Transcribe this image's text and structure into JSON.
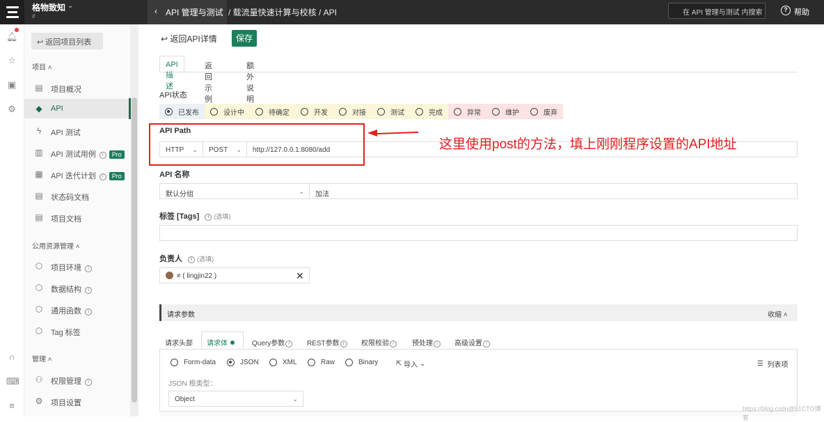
{
  "app": {
    "name": "格物致知",
    "sub": "≠"
  },
  "topbar": {
    "section": "API 管理与测试",
    "breadcrumb": "/ 载流量快速计算与校核 / API",
    "search_placeholder": "在 API 管理与测试 内搜索",
    "help": "帮助"
  },
  "nav": {
    "back": "返回项目列表",
    "sec_project": "项目",
    "items_project": [
      {
        "label": "项目概况",
        "icon": "overview-icon"
      },
      {
        "label": "API",
        "icon": "api-icon"
      },
      {
        "label": "API 测试",
        "icon": "lightning-icon"
      },
      {
        "label": "API 测试用例",
        "icon": "testcase-icon",
        "pro": "Pro"
      },
      {
        "label": "API 迭代计划",
        "icon": "plan-icon",
        "pro": "Pro"
      },
      {
        "label": "状态码文档",
        "icon": "statuscode-icon"
      },
      {
        "label": "项目文档",
        "icon": "doc-icon"
      }
    ],
    "sec_public": "公用资源管理",
    "items_public": [
      {
        "label": "项目环境"
      },
      {
        "label": "数据结构"
      },
      {
        "label": "通用函数"
      },
      {
        "label": "Tag 标签"
      }
    ],
    "sec_manage": "管理",
    "items_manage": [
      {
        "label": "权限管理"
      },
      {
        "label": "项目设置"
      }
    ]
  },
  "main": {
    "back": "返回API详情",
    "save": "保存",
    "tabs": [
      "API描述",
      "返回示例",
      "额外说明"
    ],
    "status_label": "API状态",
    "statuses": [
      "已发布",
      "设计中",
      "待确定",
      "开发",
      "对接",
      "测试",
      "完成",
      "异常",
      "维护",
      "废弃"
    ],
    "path_label": "API Path",
    "protocol": "HTTP",
    "method": "POST",
    "path_value": "http://127.0.0.1:8080/add",
    "name_label": "API 名称",
    "group": "默认分组",
    "name_value": "加法",
    "tags_label": "标签 [Tags]",
    "tags_hint": "(选填)",
    "owner_label": "负责人",
    "owner_hint": "(选填)",
    "owner_value": "≠ ( lingjin22 )",
    "req_title": "请求参数",
    "collapse": "收缩",
    "req_tabs": [
      "请求头部",
      "请求体",
      "Query参数",
      "REST参数",
      "权限校验",
      "预处理",
      "高级设置"
    ],
    "body_types": [
      "Form-data",
      "JSON",
      "XML",
      "Raw",
      "Binary"
    ],
    "import": "导入",
    "list_view": "列表项",
    "json_root_label": "JSON 根类型：",
    "json_root": "Object"
  },
  "annotation": "这里使用post的方法，填上刚刚程序设置的API地址",
  "watermark": "https://blog.csdn@51CTO博客",
  "colors": {
    "accent": "#1b7f5b",
    "annotation": "#e02020"
  }
}
